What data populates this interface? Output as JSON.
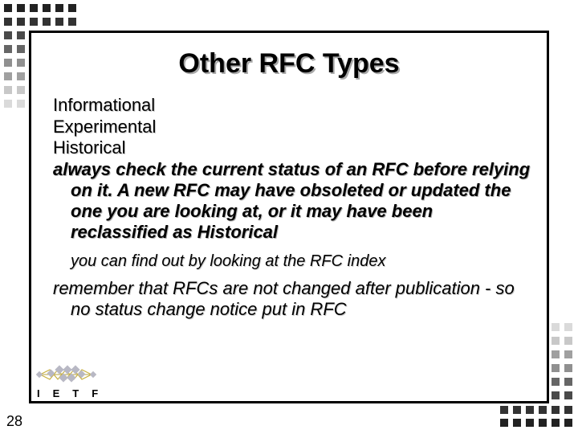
{
  "slide": {
    "title": "Other RFC Types",
    "items": [
      "Informational",
      "Experimental",
      "Historical"
    ],
    "note_strong": "always check the current status of an RFC before relying on it. A new RFC may have obsoleted or updated the one you are looking at, or it may have been reclassified as Historical",
    "sub_note": "you can find out by looking at the RFC index",
    "note_remember": "remember that RFCs are not changed after publication - so no status change notice put in RFC",
    "page_number": "28"
  },
  "logo": {
    "text": "IETF",
    "mark_icon": "ietf-diamond-chain-icon"
  },
  "colors": {
    "frame": "#000000",
    "title_shadow": "#a8a8a8",
    "square_dark": "#222222",
    "square_light": "#d8d8d8"
  }
}
